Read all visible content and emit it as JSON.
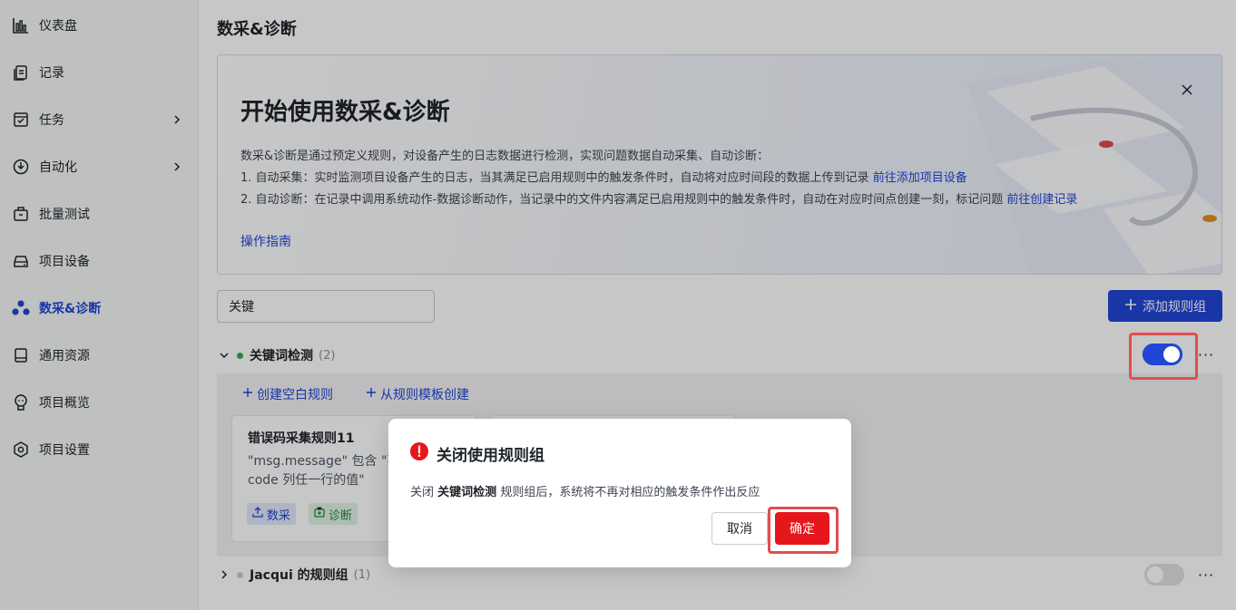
{
  "colors": {
    "accent": "#2146d6",
    "danger": "#e6161d",
    "highlight": "#e34d4d",
    "success": "#2fb04f"
  },
  "sidebar": {
    "items": [
      {
        "label": "仪表盘",
        "icon": "bar-chart-icon"
      },
      {
        "label": "记录",
        "icon": "records-icon"
      },
      {
        "label": "任务",
        "icon": "task-icon",
        "has_children": true
      },
      {
        "label": "自动化",
        "icon": "automation-icon",
        "has_children": true
      },
      {
        "label": "批量测试",
        "icon": "batch-test-icon"
      },
      {
        "label": "项目设备",
        "icon": "device-icon"
      },
      {
        "label": "数采&诊断",
        "icon": "diagnosis-icon",
        "active": true
      },
      {
        "label": "通用资源",
        "icon": "resources-icon"
      },
      {
        "label": "项目概览",
        "icon": "overview-icon"
      },
      {
        "label": "项目设置",
        "icon": "settings-icon"
      }
    ]
  },
  "page": {
    "title": "数采&诊断"
  },
  "banner": {
    "title": "开始使用数采&诊断",
    "intro": "数采&诊断是通过预定义规则，对设备产生的日志数据进行检测，实现问题数据自动采集、自动诊断：",
    "line1": "1. 自动采集：实时监测项目设备产生的日志，当其满足已启用规则中的触发条件时，自动将对应时间段的数据上传到记录",
    "line1_link": "前往添加项目设备",
    "line2": "2. 自动诊断：在记录中调用系统动作-数据诊断动作，当记录中的文件内容满足已启用规则中的触发条件时，自动在对应时间点创建一刻，标记问题",
    "line2_link": "前往创建记录",
    "guide_link": "操作指南"
  },
  "search": {
    "value": "关键"
  },
  "toolbar": {
    "add_group_label": "添加规则组"
  },
  "groups": [
    {
      "name": "关键词检测",
      "count": "(2)",
      "enabled": true,
      "expanded": true,
      "create_blank_label": "创建空白规则",
      "create_from_template_label": "从规则模板创建",
      "rules": [
        {
          "title": "错误码采集规则11",
          "desc_line1": "\"msg.message\" 包含 \"事",
          "desc_line2": "code 列任一行的值\"",
          "tags": [
            "数采",
            "诊断"
          ]
        }
      ]
    },
    {
      "name": "Jacqui 的规则组",
      "count": "(1)",
      "enabled": false,
      "expanded": false
    }
  ],
  "dialog": {
    "title": "关闭使用规则组",
    "body_prefix": "关闭",
    "body_group": "关键词检测",
    "body_suffix": "规则组后，系统将不再对相应的触发条件作出反应",
    "cancel_label": "取消",
    "confirm_label": "确定"
  }
}
